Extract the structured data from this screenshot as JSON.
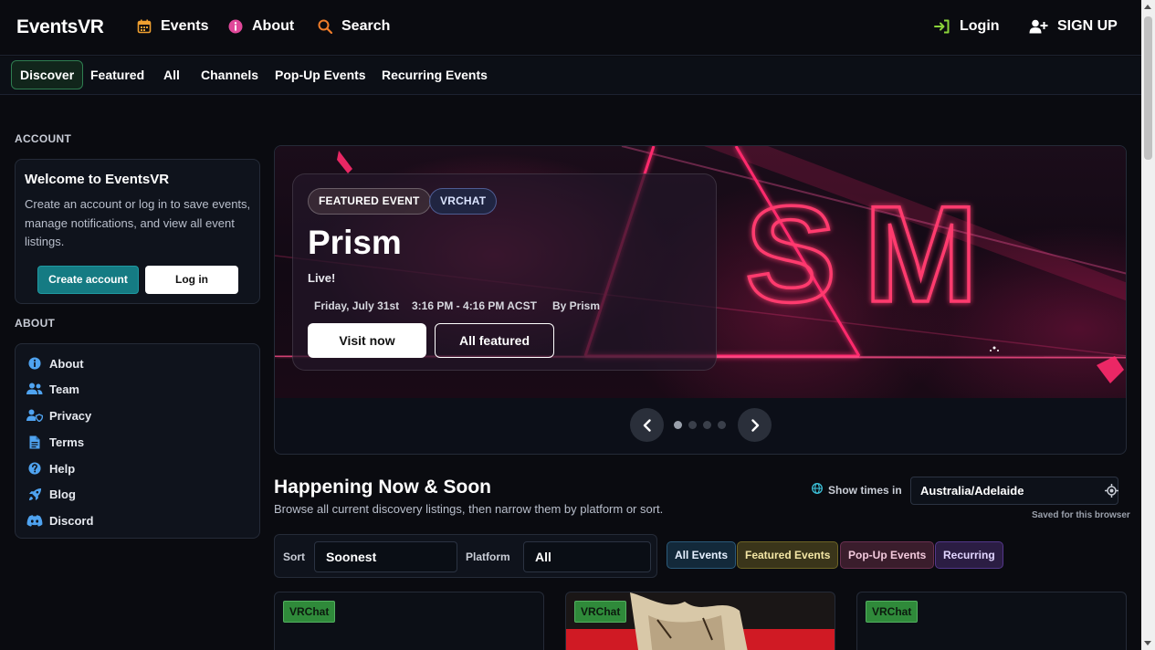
{
  "brand": "EventsVR",
  "topnav": {
    "events": "Events",
    "about": "About",
    "search": "Search",
    "login": "Login",
    "signup": "SIGN UP"
  },
  "subnav": [
    "Discover",
    "Featured",
    "All",
    "Channels",
    "Pop-Up Events",
    "Recurring Events"
  ],
  "sidebar": {
    "account_label": "ACCOUNT",
    "welcome_title": "Welcome to EventsVR",
    "welcome_text": "Create an account or log in to save events, manage notifications, and view all event listings.",
    "create_account": "Create account",
    "log_in": "Log in",
    "about_label": "ABOUT",
    "about_items": [
      {
        "label": "About",
        "icon": "info-icon"
      },
      {
        "label": "Team",
        "icon": "users-icon"
      },
      {
        "label": "Privacy",
        "icon": "user-shield-icon"
      },
      {
        "label": "Terms",
        "icon": "document-icon"
      },
      {
        "label": "Help",
        "icon": "question-icon"
      },
      {
        "label": "Blog",
        "icon": "rocket-icon"
      },
      {
        "label": "Discord",
        "icon": "discord-icon"
      }
    ]
  },
  "hero": {
    "badge_featured": "FEATURED EVENT",
    "badge_platform": "VRCHAT",
    "title": "Prism",
    "status": "Live!",
    "date": "Friday, July 31st",
    "time": "3:16 PM - 4:16 PM ACST",
    "by": "By Prism",
    "visit_now": "Visit now",
    "all_featured": "All featured",
    "art_text": "SM",
    "slide_count": 4,
    "active_slide": 1
  },
  "section": {
    "title": "Happening Now & Soon",
    "subtitle": "Browse all current discovery listings, then narrow them by platform or sort.",
    "show_times_in": "Show times in",
    "timezone": "Australia/Adelaide",
    "saved_note": "Saved for this browser"
  },
  "filters": {
    "sort_label": "Sort",
    "sort_value": "Soonest",
    "platform_label": "Platform",
    "platform_value": "All",
    "chips": [
      "All Events",
      "Featured Events",
      "Pop-Up Events",
      "Recurring"
    ]
  },
  "cards": [
    {
      "platform": "VRChat"
    },
    {
      "platform": "VRChat"
    },
    {
      "platform": "VRChat"
    }
  ],
  "colors": {
    "background": "#0a0b10",
    "accent_teal": "#157b83",
    "active_tab_border": "#2e7d50",
    "vrchat_tag": "#2f8a3a",
    "neon_pink": "#ff2a6d"
  }
}
